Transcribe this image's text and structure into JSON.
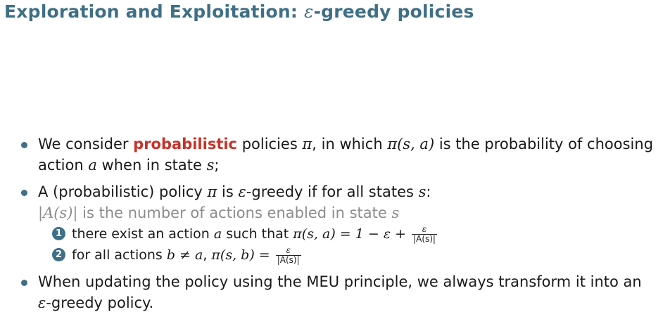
{
  "title": {
    "text": "Exploration and Exploitation: ",
    "math": "ε",
    "rest": "-greedy policies"
  },
  "bullets": {
    "b1": {
      "pre": "We consider ",
      "highlight": "probabilistic",
      "mid1": " policies ",
      "pi": "π",
      "mid2": ", in which ",
      "expr": "π(s, a)",
      "mid3": " is the probability of choosing",
      "line2a": "action ",
      "a": "a",
      "line2b": " when in state ",
      "s": "s",
      "line2c": ";"
    },
    "b2": {
      "pre": "A (probabilistic) policy ",
      "pi": "π",
      "mid": " is ",
      "eps": "ε",
      "post": "-greedy if for all states ",
      "s": "s",
      "colon": ":",
      "note_expr": "|A(s)|",
      "note_text": " is the number of actions enabled in state ",
      "note_s": "s",
      "sub1": {
        "num": "1",
        "pre": "there exist an action ",
        "a": "a",
        "mid": " such that ",
        "expr": "π(s, a) = 1 − ε + ",
        "frac_n": "ε",
        "frac_d": "|A(s)|"
      },
      "sub2": {
        "num": "2",
        "pre": "for all actions ",
        "expr1": "b ≠ a",
        "comma": ", ",
        "expr2": "π(s, b) = ",
        "frac_n": "ε",
        "frac_d": "|A(s)|"
      }
    },
    "b3": {
      "line1": "When updating the policy using the MEU principle, we always transform it into an",
      "eps": "ε",
      "line2": "-greedy policy."
    }
  },
  "colors": {
    "accent": "#3f6f86",
    "highlight": "#c8322a",
    "note": "#8c8c8c"
  }
}
